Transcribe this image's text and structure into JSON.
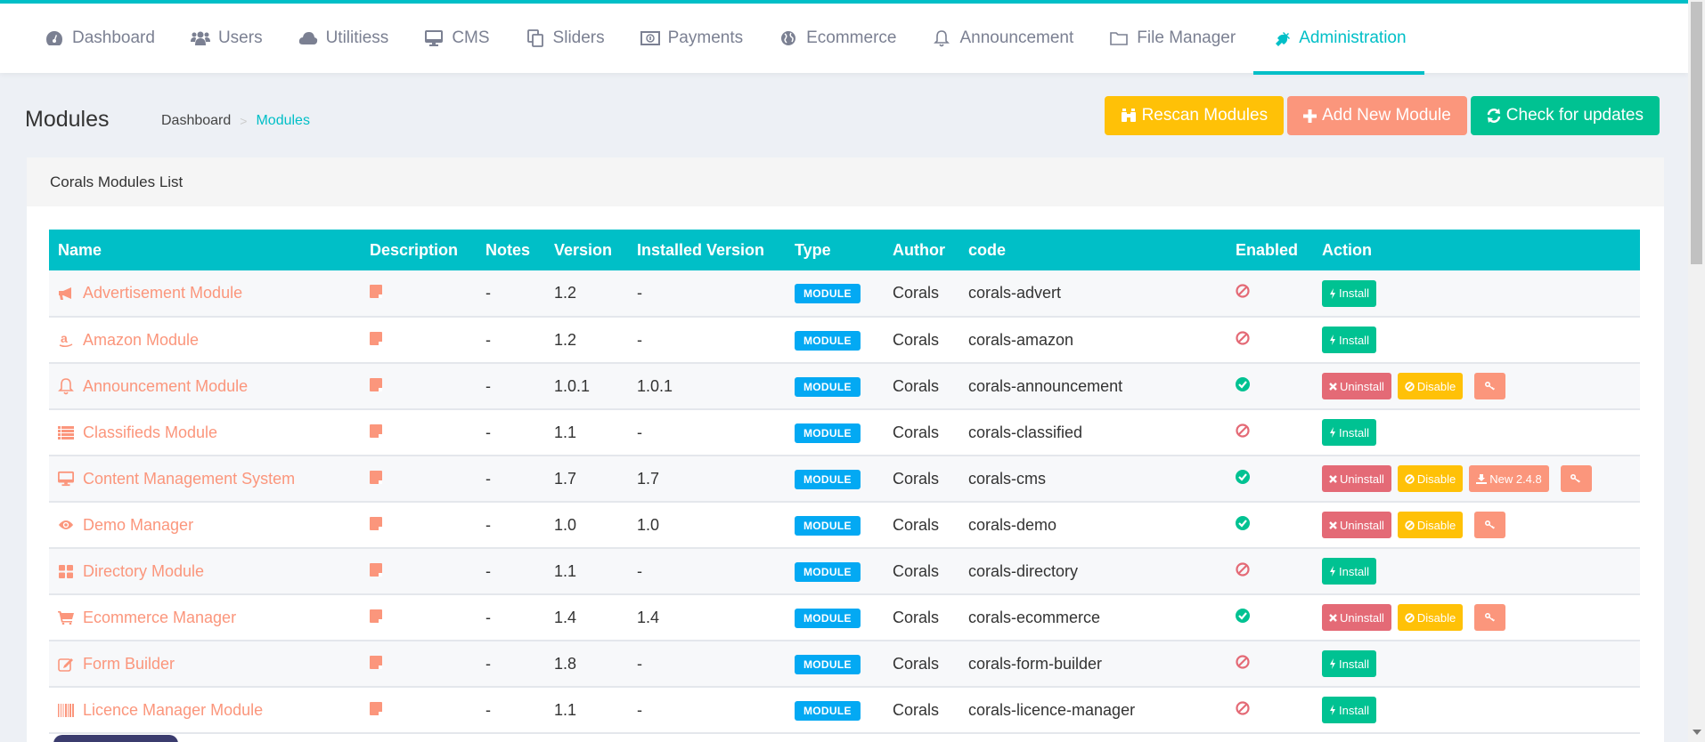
{
  "nav": {
    "items": [
      {
        "label": "Dashboard",
        "icon": "dashboard-icon",
        "active": false
      },
      {
        "label": "Users",
        "icon": "users-icon",
        "active": false
      },
      {
        "label": "Utilitiess",
        "icon": "cloud-icon",
        "active": false
      },
      {
        "label": "CMS",
        "icon": "desktop-icon",
        "active": false
      },
      {
        "label": "Sliders",
        "icon": "clone-icon",
        "active": false
      },
      {
        "label": "Payments",
        "icon": "money-icon",
        "active": false
      },
      {
        "label": "Ecommerce",
        "icon": "globe-icon",
        "active": false
      },
      {
        "label": "Announcement",
        "icon": "bell-icon",
        "active": false
      },
      {
        "label": "File Manager",
        "icon": "folder-icon",
        "active": false
      },
      {
        "label": "Administration",
        "icon": "plug-icon",
        "active": true
      }
    ]
  },
  "page": {
    "title": "Modules",
    "breadcrumb": [
      "Dashboard",
      "Modules"
    ]
  },
  "toolbar": {
    "rescan_label": "Rescan Modules",
    "add_label": "Add New Module",
    "check_label": "Check for updates"
  },
  "card": {
    "title": "Corals Modules List"
  },
  "table": {
    "columns": [
      "Name",
      "Description",
      "Notes",
      "Version",
      "Installed Version",
      "Type",
      "Author",
      "code",
      "Enabled",
      "Action"
    ],
    "rows": [
      {
        "name": "Advertisement Module",
        "icon": "bullhorn-icon",
        "notes": "-",
        "version": "1.2",
        "installed": "-",
        "type": "MODULE",
        "author": "Corals",
        "code": "corals-advert",
        "enabled": false,
        "actions": [
          "install"
        ]
      },
      {
        "name": "Amazon Module",
        "icon": "amazon-icon",
        "notes": "-",
        "version": "1.2",
        "installed": "-",
        "type": "MODULE",
        "author": "Corals",
        "code": "corals-amazon",
        "enabled": false,
        "actions": [
          "install"
        ]
      },
      {
        "name": "Announcement Module",
        "icon": "bell-icon",
        "notes": "-",
        "version": "1.0.1",
        "installed": "1.0.1",
        "type": "MODULE",
        "author": "Corals",
        "code": "corals-announcement",
        "enabled": true,
        "actions": [
          "uninstall",
          "disable",
          "key"
        ]
      },
      {
        "name": "Classifieds Module",
        "icon": "list-icon",
        "notes": "-",
        "version": "1.1",
        "installed": "-",
        "type": "MODULE",
        "author": "Corals",
        "code": "corals-classified",
        "enabled": false,
        "actions": [
          "install"
        ]
      },
      {
        "name": "Content Management System",
        "icon": "desktop-icon",
        "notes": "-",
        "version": "1.7",
        "installed": "1.7",
        "type": "MODULE",
        "author": "Corals",
        "code": "corals-cms",
        "enabled": true,
        "actions": [
          "uninstall",
          "disable",
          "update",
          "key"
        ],
        "update_label": "New 2.4.8"
      },
      {
        "name": "Demo Manager",
        "icon": "eye-icon",
        "notes": "-",
        "version": "1.0",
        "installed": "1.0",
        "type": "MODULE",
        "author": "Corals",
        "code": "corals-demo",
        "enabled": true,
        "actions": [
          "uninstall",
          "disable",
          "key"
        ]
      },
      {
        "name": "Directory Module",
        "icon": "th-large-icon",
        "notes": "-",
        "version": "1.1",
        "installed": "-",
        "type": "MODULE",
        "author": "Corals",
        "code": "corals-directory",
        "enabled": false,
        "actions": [
          "install"
        ]
      },
      {
        "name": "Ecommerce Manager",
        "icon": "cart-icon",
        "notes": "-",
        "version": "1.4",
        "installed": "1.4",
        "type": "MODULE",
        "author": "Corals",
        "code": "corals-ecommerce",
        "enabled": true,
        "actions": [
          "uninstall",
          "disable",
          "key"
        ]
      },
      {
        "name": "Form Builder",
        "icon": "edit-icon",
        "notes": "-",
        "version": "1.8",
        "installed": "-",
        "type": "MODULE",
        "author": "Corals",
        "code": "corals-form-builder",
        "enabled": false,
        "actions": [
          "install"
        ]
      },
      {
        "name": "Licence Manager Module",
        "icon": "barcode-icon",
        "notes": "-",
        "version": "1.1",
        "installed": "-",
        "type": "MODULE",
        "author": "Corals",
        "code": "corals-licence-manager",
        "enabled": false,
        "actions": [
          "install"
        ]
      }
    ],
    "action_labels": {
      "install": "Install",
      "uninstall": "Uninstall",
      "disable": "Disable"
    }
  },
  "colors": {
    "accent": "#00bfc7",
    "install": "#00c292",
    "uninstall": "#e46a76",
    "disable": "#ffc107",
    "salmon": "#fb967c",
    "badge": "#03a9f3"
  }
}
